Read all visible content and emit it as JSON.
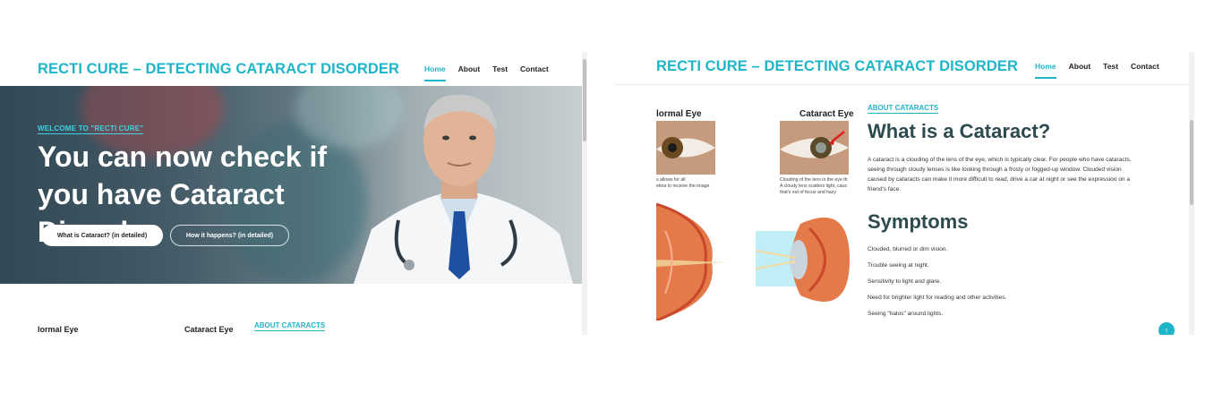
{
  "site": {
    "brand": "RECTI CURE – DETECTING CATARACT DISORDER",
    "nav": [
      {
        "label": "Home",
        "active": true
      },
      {
        "label": "About",
        "active": false
      },
      {
        "label": "Test",
        "active": false
      },
      {
        "label": "Contact",
        "active": false
      }
    ]
  },
  "hero": {
    "welcome": "WELCOME TO \"RECTI CURE\"",
    "title": "You can now check if you have Cataract Disorder",
    "primary_button": "What is Cataract? (in detailed)",
    "secondary_button": "How it happens? (in detailed)"
  },
  "left_below": {
    "normal_eye": "lormal Eye",
    "cataract_eye": "Cataract Eye",
    "about_tag": "ABOUT CATARACTS"
  },
  "right": {
    "normal_eye": "lormal Eye",
    "cataract_eye": "Cataract Eye",
    "normal_caption": "s allows for all\netina to receive the image",
    "cataract_caption": "Clouding of the lens in the eye th\nA cloudy lens scatters light, caus\nthat's out of focus and hazy",
    "about_tag": "ABOUT CATARACTS",
    "heading": "What is a Cataract?",
    "paragraph": "A cataract is a clouding of the lens of the eye, which is typically clear. For people who have cataracts, seeing through cloudy lenses is like looking through a frosty or fogged-up window. Clouded vision caused by cataracts can make it more difficult to read, drive a car at night or see the expression on a friend's face.",
    "symptoms_heading": "Symptoms",
    "symptoms": [
      "Clouded, blurred or dim vision.",
      "Trouble seeing at night.",
      "Sensitivity to light and glare.",
      "Need for brighter light for reading and other activities.",
      "Seeing \"halos\" around lights."
    ]
  },
  "icons": {
    "scroll_top": "arrow-up-icon"
  },
  "colors": {
    "accent": "#1fb5c9",
    "heading": "#2d4a4f"
  }
}
